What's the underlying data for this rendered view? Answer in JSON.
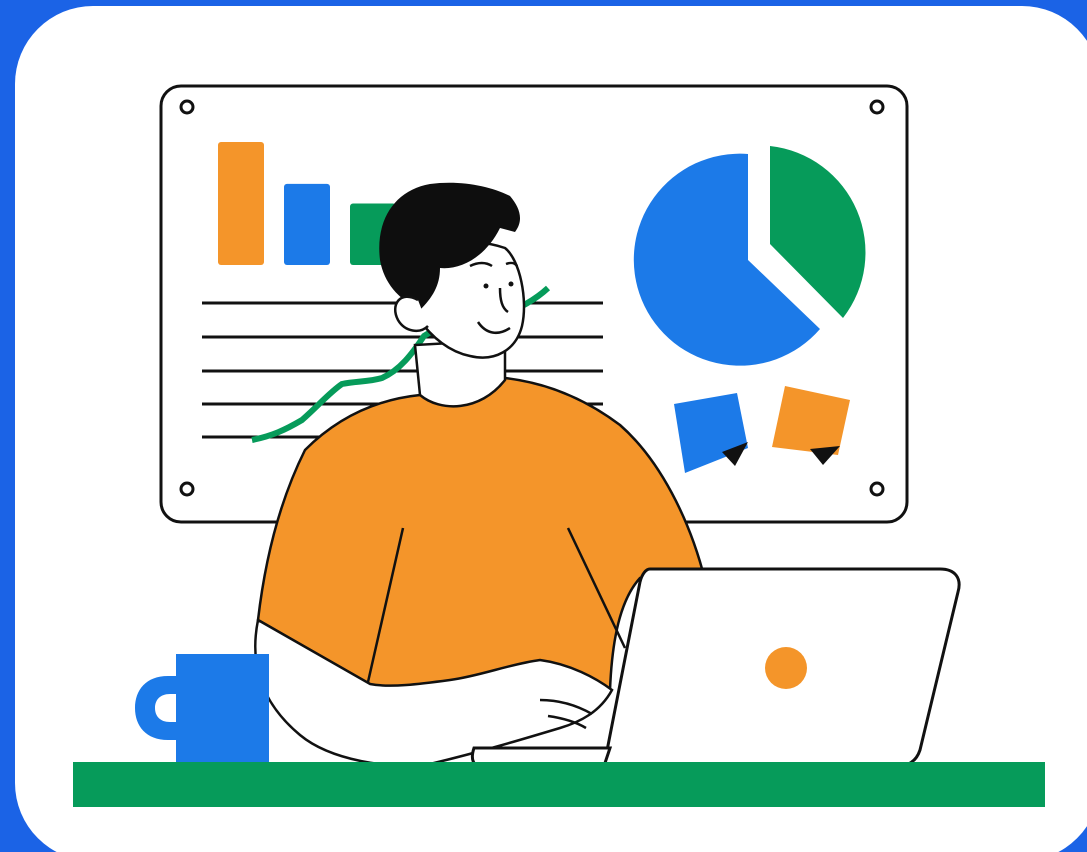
{
  "colors": {
    "background_blue": "#1B63E6",
    "card_white": "#FFFFFF",
    "outline": "#111111",
    "orange": "#F4952A",
    "blue": "#1C7AE8",
    "green": "#069B5A",
    "hair": "#0E0E0E"
  },
  "illustration": {
    "subject": "person-at-laptop-with-analytics-board",
    "board_bars": [
      {
        "color_key": "orange",
        "relative_height": 1.0
      },
      {
        "color_key": "blue",
        "relative_height": 0.66
      },
      {
        "color_key": "green",
        "relative_height": 0.5
      }
    ],
    "pie_slices": [
      {
        "color_key": "blue",
        "share": 0.63
      },
      {
        "color_key": "green",
        "share": 0.37
      }
    ],
    "sticky_notes": [
      "blue",
      "orange"
    ]
  }
}
